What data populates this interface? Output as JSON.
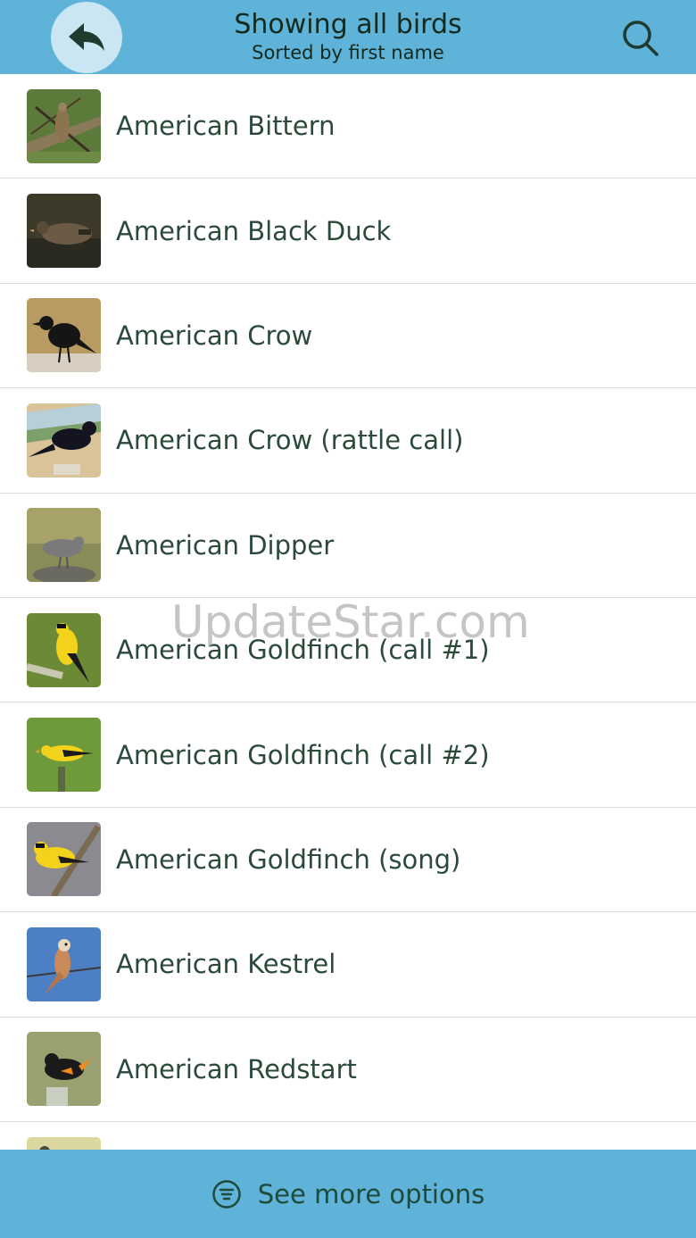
{
  "header": {
    "title": "Showing all birds",
    "subtitle": "Sorted by first name",
    "back_icon": "back-arrow-icon",
    "search_icon": "search-icon",
    "bar_color": "#5fb3d9"
  },
  "birds": [
    {
      "name": "American Bittern",
      "thumb": "bittern"
    },
    {
      "name": "American Black Duck",
      "thumb": "duck"
    },
    {
      "name": "American Crow",
      "thumb": "crow"
    },
    {
      "name": "American Crow (rattle call)",
      "thumb": "crow2"
    },
    {
      "name": "American Dipper",
      "thumb": "dipper"
    },
    {
      "name": "American Goldfinch (call #1)",
      "thumb": "goldfinch1"
    },
    {
      "name": "American Goldfinch (call #2)",
      "thumb": "goldfinch2"
    },
    {
      "name": "American Goldfinch (song)",
      "thumb": "goldfinch3"
    },
    {
      "name": "American Kestrel",
      "thumb": "kestrel"
    },
    {
      "name": "American Redstart",
      "thumb": "redstart"
    },
    {
      "name": "",
      "thumb": "partial"
    }
  ],
  "watermark": "UpdateStar.com",
  "footer": {
    "label": "See more options",
    "icon": "filter-lines-icon"
  }
}
